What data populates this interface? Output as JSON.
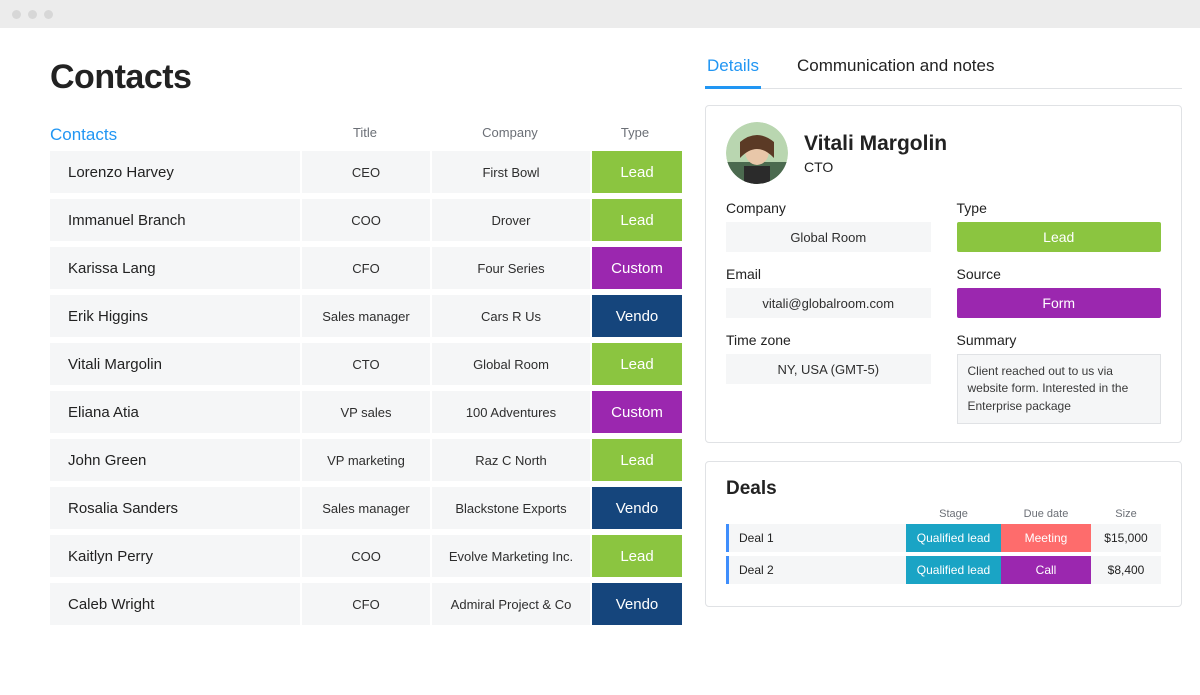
{
  "page_title": "Contacts",
  "columns": {
    "name": "Contacts",
    "title": "Title",
    "company": "Company",
    "type": "Type"
  },
  "type_labels": {
    "lead": "Lead",
    "customer": "Custom",
    "vendor": "Vendo"
  },
  "contacts": [
    {
      "name": "Lorenzo Harvey",
      "title": "CEO",
      "company": "First Bowl",
      "type": "lead"
    },
    {
      "name": "Immanuel Branch",
      "title": "COO",
      "company": "Drover",
      "type": "lead"
    },
    {
      "name": "Karissa Lang",
      "title": "CFO",
      "company": "Four Series",
      "type": "customer"
    },
    {
      "name": "Erik Higgins",
      "title": "Sales manager",
      "company": "Cars R Us",
      "type": "vendor"
    },
    {
      "name": "Vitali Margolin",
      "title": "CTO",
      "company": "Global Room",
      "type": "lead"
    },
    {
      "name": "Eliana Atia",
      "title": "VP sales",
      "company": "100 Adventures",
      "type": "customer"
    },
    {
      "name": "John Green",
      "title": "VP marketing",
      "company": "Raz C North",
      "type": "lead"
    },
    {
      "name": "Rosalia Sanders",
      "title": "Sales manager",
      "company": "Blackstone Exports",
      "type": "vendor"
    },
    {
      "name": "Kaitlyn Perry",
      "title": "COO",
      "company": "Evolve Marketing Inc.",
      "type": "lead"
    },
    {
      "name": "Caleb Wright",
      "title": "CFO",
      "company": "Admiral Project & Co",
      "type": "vendor"
    }
  ],
  "tabs": {
    "details": "Details",
    "comm": "Communication and notes"
  },
  "detail": {
    "name": "Vitali Margolin",
    "role": "CTO",
    "labels": {
      "company": "Company",
      "type": "Type",
      "email": "Email",
      "source": "Source",
      "timezone": "Time zone",
      "summary": "Summary"
    },
    "company": "Global Room",
    "type": "Lead",
    "email": "vitali@globalroom.com",
    "source": "Form",
    "timezone": "NY, USA (GMT-5)",
    "summary": "Client reached out to us via website form. Interested in the Enterprise package"
  },
  "deals": {
    "title": "Deals",
    "columns": {
      "stage": "Stage",
      "due": "Due date",
      "size": "Size"
    },
    "rows": [
      {
        "name": "Deal 1",
        "stage": "Qualified lead",
        "due": "Meeting",
        "due_kind": "meeting",
        "size": "$15,000"
      },
      {
        "name": "Deal 2",
        "stage": "Qualified lead",
        "due": "Call",
        "due_kind": "call",
        "size": "$8,400"
      }
    ]
  }
}
